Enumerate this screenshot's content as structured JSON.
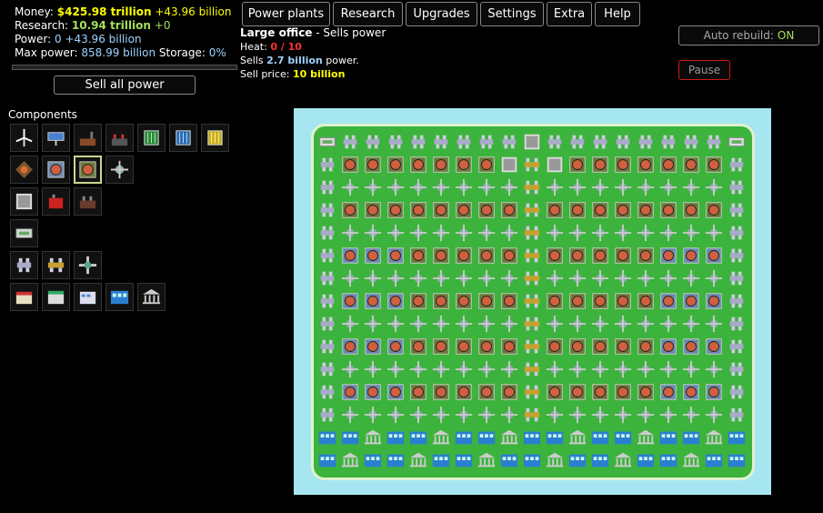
{
  "stats": {
    "money_label": "Money:",
    "money_value": "$425.98 trillion",
    "money_rate": "+43.96 billion",
    "research_label": "Research:",
    "research_value": "10.94 trillion",
    "research_rate": "+0",
    "power_label": "Power:",
    "power_value": "0",
    "power_rate": "+43.96 billion",
    "maxpower_label": "Max power:",
    "maxpower_value": "858.99 billion",
    "storage_label": "Storage:",
    "storage_value": "0%",
    "power_fill": 0
  },
  "sell_all_label": "Sell all power",
  "tabs": [
    "Power plants",
    "Research",
    "Upgrades",
    "Settings",
    "Extra",
    "Help"
  ],
  "info": {
    "name": "Large office",
    "sep": " - ",
    "desc": "Sells power",
    "heat_label": "Heat:",
    "heat_value": "0 / 10",
    "sells_prefix": "Sells",
    "sells_value": "2.7 billion",
    "sells_suffix": "power.",
    "price_label": "Sell price:",
    "price_value": "10 billion"
  },
  "auto_rebuild": {
    "label": "Auto rebuild:",
    "state": "ON"
  },
  "pause_label": "Pause",
  "components_heading": "Components",
  "components": [
    "wind-turbine-icon",
    "solar-panel-icon",
    "coal-plant-icon",
    "gas-plant-icon",
    "green-battery-icon",
    "blue-battery-icon",
    "yellow-battery-icon",
    "heat-exchanger-icon",
    "cooler-icon",
    "large-cooler-icon",
    "fan-icon",
    "wall-icon",
    "red-generator-icon",
    "factory-icon",
    "sign-icon",
    "transmitter-icon",
    "large-transmitter-icon",
    "pylon-icon",
    "shop-icon",
    "small-office-icon",
    "office-icon",
    "large-office-icon",
    "bank-icon"
  ],
  "colors": {
    "money": "#ffff00",
    "research": "#a4e05a",
    "water": "#a6e6f0",
    "grass": "#3cb33c",
    "pause_border": "#d01818"
  }
}
